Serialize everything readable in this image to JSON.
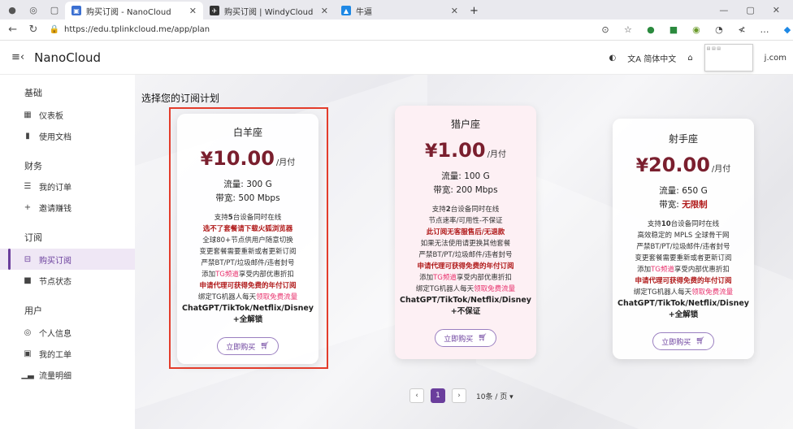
{
  "browser": {
    "tabs": [
      {
        "title": "购买订阅 - NanoCloud",
        "active": true
      },
      {
        "title": "购买订阅 | WindyCloud",
        "active": false
      },
      {
        "title": "牛逼",
        "active": false
      }
    ],
    "new_tab": "+",
    "url": "https://edu.tplinkcloud.me/app/plan"
  },
  "header": {
    "brand": "NanoCloud",
    "language": "简体中文",
    "user_suffix": "j.com"
  },
  "sidebar": {
    "sections": [
      {
        "title": "基础",
        "items": [
          {
            "label": "仪表板"
          },
          {
            "label": "使用文档"
          }
        ]
      },
      {
        "title": "财务",
        "items": [
          {
            "label": "我的订单"
          },
          {
            "label": "邀请赚钱"
          }
        ]
      },
      {
        "title": "订阅",
        "items": [
          {
            "label": "购买订阅",
            "active": true
          },
          {
            "label": "节点状态"
          }
        ]
      },
      {
        "title": "用户",
        "items": [
          {
            "label": "个人信息"
          },
          {
            "label": "我的工单"
          },
          {
            "label": "流量明细"
          }
        ]
      }
    ]
  },
  "main": {
    "title": "选择您的订阅计划",
    "plans": [
      {
        "name": "白羊座",
        "currency": "¥",
        "price": "10.00",
        "period": "/月付",
        "traffic_label": "流量: ",
        "traffic": "300 G",
        "bandwidth_label": "带宽: ",
        "bandwidth": "500 Mbps",
        "features": [
          {
            "pre": "支持",
            "em": "5",
            "post": "台设备同时在线"
          },
          {
            "text": "选不了套餐请下载火狐浏览器",
            "style": "red"
          },
          {
            "text": "全球80+节点供用户随意切换"
          },
          {
            "text": "变更套餐需要重新或者更新订阅"
          },
          {
            "text": "严禁BT/PT/垃圾邮件/违者封号"
          },
          {
            "pre": "添加",
            "pk": "TG频道",
            "post": "享受内部优惠折扣"
          },
          {
            "text": "申请代理可获得免费的年付订阅",
            "style": "red"
          },
          {
            "pre": "绑定TG机器人每天",
            "pk": "领取免费流量",
            "post": ""
          },
          {
            "text": "ChatGPT/TikTok/Netflix/Disney",
            "style": "bold"
          },
          {
            "text": "+全解锁",
            "style": "bold"
          }
        ],
        "buy_label": "立即购买"
      },
      {
        "name": "猎户座",
        "currency": "¥",
        "price": "1.00",
        "period": "/月付",
        "traffic_label": "流量: ",
        "traffic": "100 G",
        "bandwidth_label": "带宽: ",
        "bandwidth": "200 Mbps",
        "features": [
          {
            "pre": "支持",
            "em": "2",
            "post": "台设备同时在线"
          },
          {
            "text": "节点速率/可用性-不保证"
          },
          {
            "text": "此订阅无客服售后/无退款",
            "style": "red"
          },
          {
            "text": "如果无法使用请更换其他套餐"
          },
          {
            "text": "严禁BT/PT/垃圾邮件/违者封号"
          },
          {
            "text": "申请代理可获得免费的年付订阅",
            "style": "red"
          },
          {
            "pre": "添加",
            "pk": "TG频道",
            "post": "享受内部优惠折扣"
          },
          {
            "pre": "绑定TG机器人每天",
            "pk": "领取免费流量",
            "post": ""
          },
          {
            "text": "ChatGPT/TikTok/Netflix/Disney",
            "style": "bold"
          },
          {
            "text": "+不保证",
            "style": "bold"
          }
        ],
        "buy_label": "立即购买"
      },
      {
        "name": "射手座",
        "currency": "¥",
        "price": "20.00",
        "period": "/月付",
        "traffic_label": "流量: ",
        "traffic": "650 G",
        "bandwidth_label": "带宽: ",
        "bandwidth": "无限制",
        "features": [
          {
            "pre": "支持",
            "em": "10",
            "post": "台设备同时在线"
          },
          {
            "text": "高效稳定的 MPLS 全球骨干网"
          },
          {
            "text": "严禁BT/PT/垃圾邮件/违者封号"
          },
          {
            "text": "变更套餐需要重新或者更新订阅"
          },
          {
            "pre": "添加",
            "pk": "TG频道",
            "post": "享受内部优惠折扣"
          },
          {
            "text": "申请代理可获得免费的年付订阅",
            "style": "red"
          },
          {
            "pre": "绑定TG机器人每天",
            "pk": "领取免费流量",
            "post": ""
          },
          {
            "text": "ChatGPT/TikTok/Netflix/Disney",
            "style": "bold"
          },
          {
            "text": "+全解锁",
            "style": "bold"
          }
        ],
        "buy_label": "立即购买"
      }
    ],
    "pagination": {
      "current": "1",
      "page_size": "10条 / 页"
    }
  },
  "colors": {
    "accent": "#6a3e9c",
    "price": "#7a1f2e",
    "highlight": "#e33c2b",
    "warn": "#b01919",
    "pink": "#e8326d"
  },
  "icons": [
    "menu-icon",
    "dashboard-icon",
    "docs-icon",
    "orders-icon",
    "invite-icon",
    "cart-icon",
    "nodes-icon",
    "user-icon",
    "ticket-icon",
    "traffic-icon",
    "translate-icon",
    "palette-icon"
  ]
}
